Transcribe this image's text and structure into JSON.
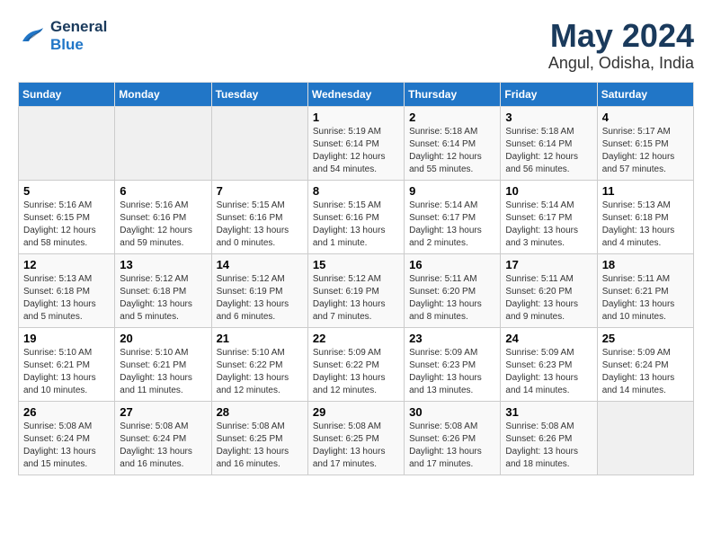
{
  "header": {
    "logo_line1": "General",
    "logo_line2": "Blue",
    "month_year": "May 2024",
    "location": "Angul, Odisha, India"
  },
  "days_of_week": [
    "Sunday",
    "Monday",
    "Tuesday",
    "Wednesday",
    "Thursday",
    "Friday",
    "Saturday"
  ],
  "weeks": [
    [
      {
        "day": "",
        "info": ""
      },
      {
        "day": "",
        "info": ""
      },
      {
        "day": "",
        "info": ""
      },
      {
        "day": "1",
        "info": "Sunrise: 5:19 AM\nSunset: 6:14 PM\nDaylight: 12 hours\nand 54 minutes."
      },
      {
        "day": "2",
        "info": "Sunrise: 5:18 AM\nSunset: 6:14 PM\nDaylight: 12 hours\nand 55 minutes."
      },
      {
        "day": "3",
        "info": "Sunrise: 5:18 AM\nSunset: 6:14 PM\nDaylight: 12 hours\nand 56 minutes."
      },
      {
        "day": "4",
        "info": "Sunrise: 5:17 AM\nSunset: 6:15 PM\nDaylight: 12 hours\nand 57 minutes."
      }
    ],
    [
      {
        "day": "5",
        "info": "Sunrise: 5:16 AM\nSunset: 6:15 PM\nDaylight: 12 hours\nand 58 minutes."
      },
      {
        "day": "6",
        "info": "Sunrise: 5:16 AM\nSunset: 6:16 PM\nDaylight: 12 hours\nand 59 minutes."
      },
      {
        "day": "7",
        "info": "Sunrise: 5:15 AM\nSunset: 6:16 PM\nDaylight: 13 hours\nand 0 minutes."
      },
      {
        "day": "8",
        "info": "Sunrise: 5:15 AM\nSunset: 6:16 PM\nDaylight: 13 hours\nand 1 minute."
      },
      {
        "day": "9",
        "info": "Sunrise: 5:14 AM\nSunset: 6:17 PM\nDaylight: 13 hours\nand 2 minutes."
      },
      {
        "day": "10",
        "info": "Sunrise: 5:14 AM\nSunset: 6:17 PM\nDaylight: 13 hours\nand 3 minutes."
      },
      {
        "day": "11",
        "info": "Sunrise: 5:13 AM\nSunset: 6:18 PM\nDaylight: 13 hours\nand 4 minutes."
      }
    ],
    [
      {
        "day": "12",
        "info": "Sunrise: 5:13 AM\nSunset: 6:18 PM\nDaylight: 13 hours\nand 5 minutes."
      },
      {
        "day": "13",
        "info": "Sunrise: 5:12 AM\nSunset: 6:18 PM\nDaylight: 13 hours\nand 5 minutes."
      },
      {
        "day": "14",
        "info": "Sunrise: 5:12 AM\nSunset: 6:19 PM\nDaylight: 13 hours\nand 6 minutes."
      },
      {
        "day": "15",
        "info": "Sunrise: 5:12 AM\nSunset: 6:19 PM\nDaylight: 13 hours\nand 7 minutes."
      },
      {
        "day": "16",
        "info": "Sunrise: 5:11 AM\nSunset: 6:20 PM\nDaylight: 13 hours\nand 8 minutes."
      },
      {
        "day": "17",
        "info": "Sunrise: 5:11 AM\nSunset: 6:20 PM\nDaylight: 13 hours\nand 9 minutes."
      },
      {
        "day": "18",
        "info": "Sunrise: 5:11 AM\nSunset: 6:21 PM\nDaylight: 13 hours\nand 10 minutes."
      }
    ],
    [
      {
        "day": "19",
        "info": "Sunrise: 5:10 AM\nSunset: 6:21 PM\nDaylight: 13 hours\nand 10 minutes."
      },
      {
        "day": "20",
        "info": "Sunrise: 5:10 AM\nSunset: 6:21 PM\nDaylight: 13 hours\nand 11 minutes."
      },
      {
        "day": "21",
        "info": "Sunrise: 5:10 AM\nSunset: 6:22 PM\nDaylight: 13 hours\nand 12 minutes."
      },
      {
        "day": "22",
        "info": "Sunrise: 5:09 AM\nSunset: 6:22 PM\nDaylight: 13 hours\nand 12 minutes."
      },
      {
        "day": "23",
        "info": "Sunrise: 5:09 AM\nSunset: 6:23 PM\nDaylight: 13 hours\nand 13 minutes."
      },
      {
        "day": "24",
        "info": "Sunrise: 5:09 AM\nSunset: 6:23 PM\nDaylight: 13 hours\nand 14 minutes."
      },
      {
        "day": "25",
        "info": "Sunrise: 5:09 AM\nSunset: 6:24 PM\nDaylight: 13 hours\nand 14 minutes."
      }
    ],
    [
      {
        "day": "26",
        "info": "Sunrise: 5:08 AM\nSunset: 6:24 PM\nDaylight: 13 hours\nand 15 minutes."
      },
      {
        "day": "27",
        "info": "Sunrise: 5:08 AM\nSunset: 6:24 PM\nDaylight: 13 hours\nand 16 minutes."
      },
      {
        "day": "28",
        "info": "Sunrise: 5:08 AM\nSunset: 6:25 PM\nDaylight: 13 hours\nand 16 minutes."
      },
      {
        "day": "29",
        "info": "Sunrise: 5:08 AM\nSunset: 6:25 PM\nDaylight: 13 hours\nand 17 minutes."
      },
      {
        "day": "30",
        "info": "Sunrise: 5:08 AM\nSunset: 6:26 PM\nDaylight: 13 hours\nand 17 minutes."
      },
      {
        "day": "31",
        "info": "Sunrise: 5:08 AM\nSunset: 6:26 PM\nDaylight: 13 hours\nand 18 minutes."
      },
      {
        "day": "",
        "info": ""
      }
    ]
  ]
}
